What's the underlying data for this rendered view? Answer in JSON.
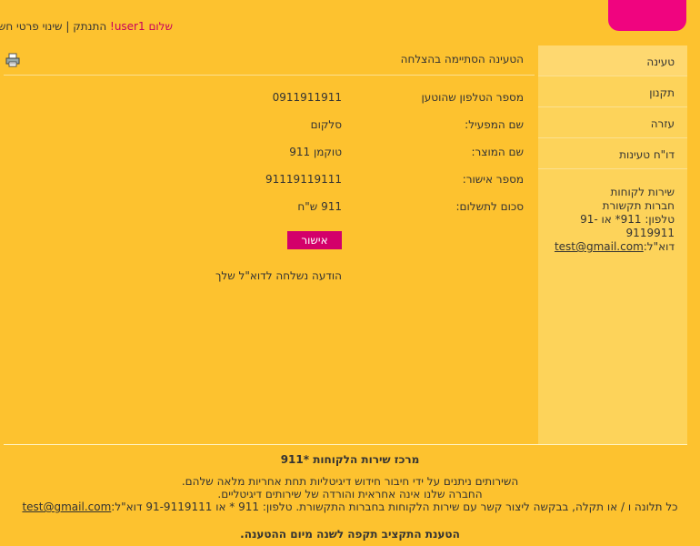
{
  "header": {
    "greeting_prefix": "שלום ",
    "username": "user1",
    "greeting_suffix": "!",
    "logout": "התנתק",
    "separator": "|",
    "account": "שינוי פרטי חשבון"
  },
  "sidebar": {
    "items": [
      {
        "label": "טעינה"
      },
      {
        "label": "תקנון"
      },
      {
        "label": "עזרה"
      },
      {
        "label": "דו\"ח טעינות"
      }
    ],
    "contact": {
      "line1": "שירות לקוחות",
      "line2": "חברות תקשורת",
      "phone": "טלפון: 911* או 91-9119911",
      "email_label": "דוא\"ל:",
      "email": "test@gmail.com"
    }
  },
  "main": {
    "title": "הטעינה הסתיימה בהצלחה",
    "rows": [
      {
        "label": "מספר הטלפון שהוטען",
        "value": "0911911911"
      },
      {
        "label": "שם המפעיל:",
        "value": "סלקום"
      },
      {
        "label": "שם המוצר:",
        "value": "טוקמן 911"
      },
      {
        "label": "מספר אישור:",
        "value": "91119119111"
      },
      {
        "label": "סכום לתשלום:",
        "value": "911 ש\"ח"
      }
    ],
    "confirm_button": "אישור",
    "sent_message": "הודעה נשלחה לדוא\"ל שלך"
  },
  "footer": {
    "title": "מרכז שירות הלקוחות *911",
    "line1": "השירותים ניתנים על ידי חיבור חידוש דיגיטליות תחת אחריות מלאה שלהם.",
    "line2": "החברה שלנו אינה אחראית והורדה של שירותים דיגיטליים.",
    "line3": "כל תלונה ו / או תקלה, בבקשה ליצור קשר עם שירות הלקוחות בחברות התקשורת. טלפון: 911 * או 91-9119111 דוא\"ל:",
    "email": "test@gmail.com",
    "bottom": "הטענת התקציב תקפה לשנה מיום ההטענה."
  }
}
